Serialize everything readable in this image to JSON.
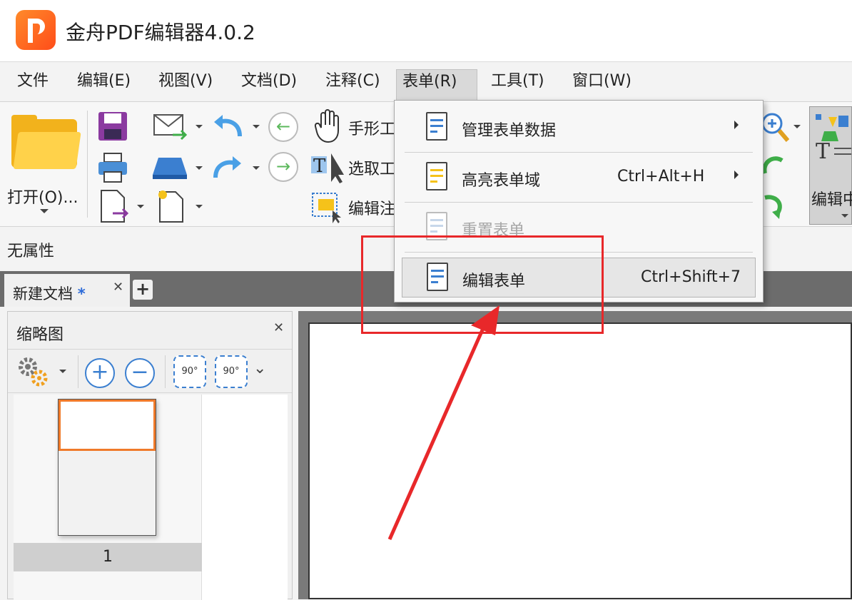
{
  "app": {
    "title": "金舟PDF编辑器4.0.2"
  },
  "menubar": {
    "items": [
      {
        "label": "文件"
      },
      {
        "label": "编辑(E)"
      },
      {
        "label": "视图(V)"
      },
      {
        "label": "文档(D)"
      },
      {
        "label": "注释(C)"
      },
      {
        "label": "表单(R)"
      },
      {
        "label": "工具(T)"
      },
      {
        "label": "窗口(W)"
      }
    ]
  },
  "toolbar": {
    "open_label": "打开(O)...",
    "hand_tool": "手形工",
    "select_tool": "选取工",
    "edit_annot": "编辑注",
    "edit_form_right": "编辑中"
  },
  "properties": {
    "label": "无属性"
  },
  "tabs": {
    "doc_tab": "新建文档",
    "modified_mark": "*"
  },
  "thumbnails": {
    "title": "缩略图",
    "page_number": "1",
    "rotate_label": "90°"
  },
  "dropdown": {
    "items": [
      {
        "label": "管理表单数据",
        "shortcut": ""
      },
      {
        "label": "高亮表单域",
        "shortcut": "Ctrl+Alt+H"
      },
      {
        "label": "重置表单",
        "shortcut": ""
      },
      {
        "label": "编辑表单",
        "shortcut": "Ctrl+Shift+7"
      }
    ]
  },
  "colors": {
    "accent": "#3b7fd0",
    "highlight": "#e8282a",
    "thumb_border": "#f07a2a"
  }
}
